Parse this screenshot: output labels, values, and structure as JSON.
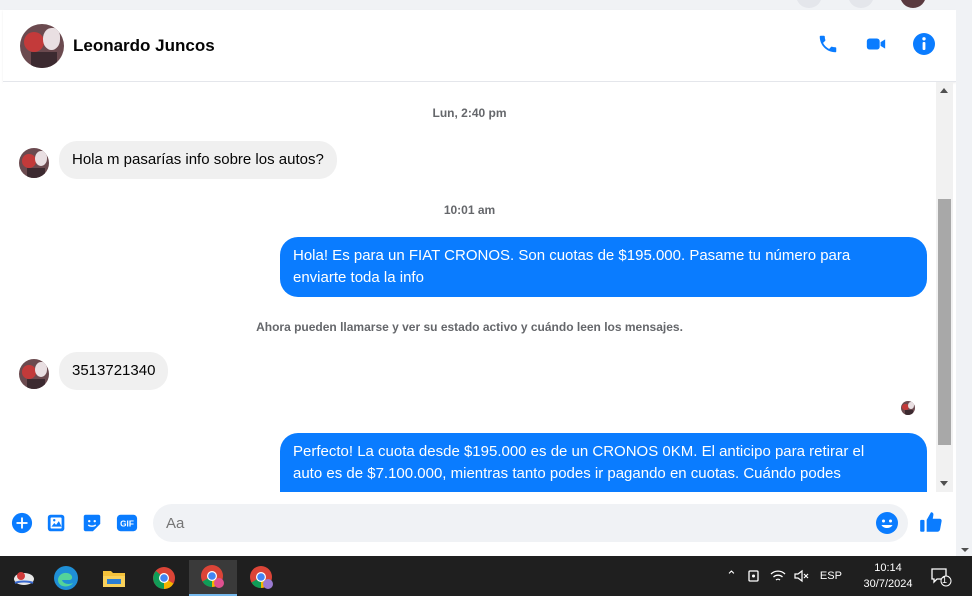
{
  "header": {
    "contact_name": "Leonardo Juncos",
    "icons": [
      "phone-icon",
      "video-call-icon",
      "info-icon"
    ]
  },
  "accent_color": "#0a7cff",
  "conversation": {
    "timestamp_1": "Lun, 2:40 pm",
    "msg_1": "Hola m pasarías info sobre los autos?",
    "timestamp_2": "10:01 am",
    "msg_2_line1": "Hola! Es para un FIAT CRONOS. Son cuotas de $195.000. Pasame tu número para",
    "msg_2_line2": "enviarte toda la info",
    "system_note": "Ahora pueden llamarse y ver su estado activo y cuándo leen los mensajes.",
    "msg_3": "3513721340",
    "msg_4_line1": "Perfecto! La cuota desde $195.000 es de un CRONOS 0KM. El anticipo para retirar el",
    "msg_4_line2": "auto es de $7.100.000, mientras tanto podes ir pagando en cuotas. Cuándo podes"
  },
  "composer": {
    "placeholder": "Aa",
    "tools": [
      "add-icon",
      "gallery-icon",
      "sticker-icon",
      "gif-icon"
    ],
    "gif_label": "GIF"
  },
  "taskbar": {
    "apps": [
      "start-icon",
      "edge-icon",
      "file-explorer-icon",
      "chrome-icon",
      "chrome-profile-icon",
      "chrome-profile-2-icon"
    ],
    "language": "ESP",
    "time": "10:14",
    "date": "30/7/2024",
    "notification_count": "1"
  }
}
